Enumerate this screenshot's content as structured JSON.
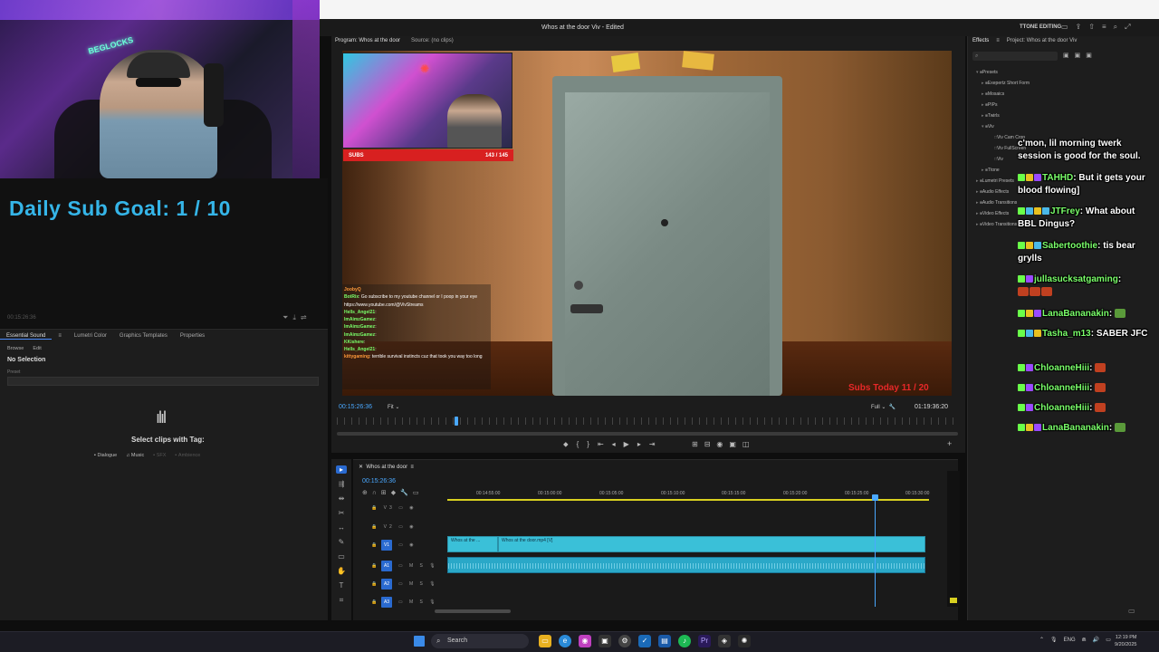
{
  "stream": {
    "sub_goal": "Daily Sub Goal:  1 / 10",
    "left_timecode": "00:15:26:36",
    "subs_label": "SUBS",
    "subs_count": "143 / 145",
    "subs_today": "Subs Today 11 / 20",
    "webcam_sign": "BEGLOCKS"
  },
  "premiere": {
    "title": "Whos at the door Viv - Edited",
    "workspace": "TTONE EDITING",
    "program_tab": "Program: Whos at the door",
    "source_tab": "Source: (no clips)",
    "pm_timecode": "00:15:26:36",
    "pm_fit": "Fit",
    "pm_full": "Full",
    "pm_duration": "01:19:36:20",
    "ess_tabs": [
      "Essential Sound",
      "Lumetri Color",
      "Graphics Templates",
      "Properties"
    ],
    "ess_subtabs": [
      "Browse",
      "Edit"
    ],
    "no_selection": "No Selection",
    "preset_label": "Preset",
    "select_tag": "Select clips with Tag:",
    "tags": [
      "Dialogue",
      "Music",
      "SFX",
      "Ambience"
    ],
    "effects_tab": "Effects",
    "project_tab": "Project: Whos at the door Viv",
    "effects_tree": [
      {
        "label": "Presets",
        "depth": 0,
        "open": true
      },
      {
        "label": "Exepertz Short Form",
        "depth": 1
      },
      {
        "label": "Mosaics",
        "depth": 1
      },
      {
        "label": "PIPs",
        "depth": 1
      },
      {
        "label": "Twirls",
        "depth": 1
      },
      {
        "label": "Viv",
        "depth": 1,
        "open": true
      },
      {
        "label": "Viv Cam Crop",
        "depth": 2,
        "leaf": true
      },
      {
        "label": "Viv FullScreen",
        "depth": 2,
        "leaf": true
      },
      {
        "label": "Viv",
        "depth": 2,
        "leaf": true
      },
      {
        "label": "Ttone",
        "depth": 1
      },
      {
        "label": "Lumetri Presets",
        "depth": 0
      },
      {
        "label": "Audio Effects",
        "depth": 0
      },
      {
        "label": "Audio Transitions",
        "depth": 0
      },
      {
        "label": "Video Effects",
        "depth": 0
      },
      {
        "label": "Video Transitions",
        "depth": 0
      }
    ],
    "timeline_title": "Whos at the door",
    "timeline_timecode": "00:15:26:36",
    "ruler_ticks": [
      "00:14:55:00",
      "00:15:00:00",
      "00:15:05:00",
      "00:15:10:00",
      "00:15:15:00",
      "00:15:20:00",
      "00:15:25:00",
      "00:15:30:00"
    ],
    "tracks": [
      "V3",
      "V2",
      "V1",
      "A1",
      "A2",
      "A3"
    ],
    "clip_v1_a": "Whos at the ...",
    "clip_v1_b": "Whos at the door.mp4 [V]"
  },
  "overlay_chat": [
    {
      "user": "JoobyQ",
      "text": ""
    },
    {
      "user": "BotRix",
      "text": ": Go subscribe to my youtube channel or I poop in your eye https://www.youtube.com/@VivStreams"
    },
    {
      "user": "Hells_Angel21",
      "text": ":"
    },
    {
      "user": "ImAimzGamez",
      "text": ":"
    },
    {
      "user": "ImAimzGamez",
      "text": ":"
    },
    {
      "user": "ImAimzGamez",
      "text": ":"
    },
    {
      "user": "KKishere",
      "text": ":"
    },
    {
      "user": "Hells_Angel21",
      "text": ":"
    },
    {
      "user": "kittygaming",
      "text": ": terrible survival instincts cuz that took you way too long"
    }
  ],
  "chat": [
    {
      "user": "",
      "text": "c'mon, lil morning twerk session is good for the soul."
    },
    {
      "user": "TAHHD",
      "text": ": But it gets your blood flowing]"
    },
    {
      "user": "JTFrey",
      "text": ": What about BBL Dingus?"
    },
    {
      "user": "Sabertoothie",
      "text": ": tis bear grylls"
    },
    {
      "user": "jullasucksatgaming",
      "text": ":"
    },
    {
      "user": "LanaBananakin",
      "text": ":"
    },
    {
      "user": "Tasha_m13",
      "text": ": SABER JFC"
    },
    {
      "user": "ChloanneHiii",
      "text": ":"
    },
    {
      "user": "ChloanneHiii",
      "text": ":"
    },
    {
      "user": "ChloanneHiii",
      "text": ":"
    },
    {
      "user": "LanaBananakin",
      "text": ":"
    }
  ],
  "taskbar": {
    "search": "Search",
    "lang": "ENG",
    "time": "12:19 PM",
    "date": "9/20/2025"
  }
}
